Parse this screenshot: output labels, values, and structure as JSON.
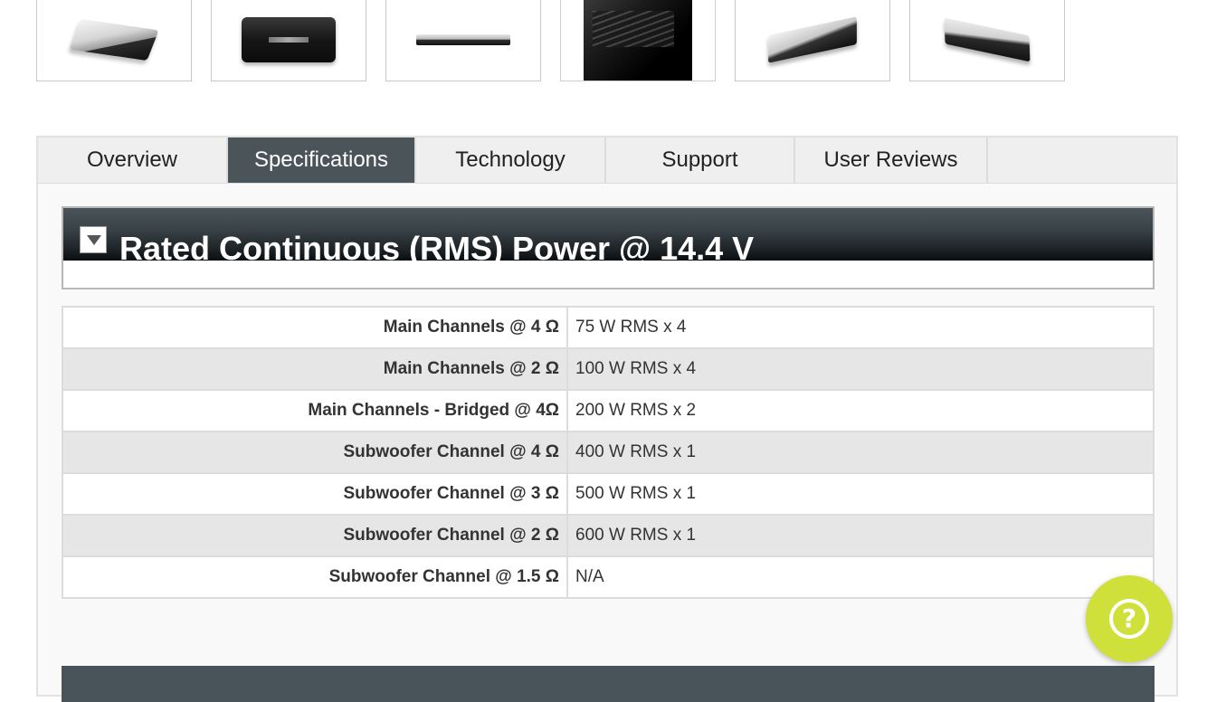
{
  "thumbnails": [
    {
      "icon": "amplifier-silver-angle-image"
    },
    {
      "icon": "amplifier-black-top-image"
    },
    {
      "icon": "amplifier-side-profile-image"
    },
    {
      "icon": "amplifier-closeup-dark-image"
    },
    {
      "icon": "amplifier-open-panel-image"
    },
    {
      "icon": "amplifier-silver-tilted-image"
    }
  ],
  "tabs": [
    {
      "label": "Overview",
      "active": false
    },
    {
      "label": "Specifications",
      "active": true
    },
    {
      "label": "Technology",
      "active": false
    },
    {
      "label": "Support",
      "active": false
    },
    {
      "label": "User Reviews",
      "active": false
    }
  ],
  "section": {
    "title": "Rated Continuous (RMS) Power @ 14.4 V"
  },
  "specs": [
    {
      "label": "Main Channels @ 4 Ω",
      "value": "75 W RMS x 4"
    },
    {
      "label": "Main Channels @ 2 Ω",
      "value": "100 W RMS x 4"
    },
    {
      "label": "Main Channels - Bridged @ 4Ω",
      "value": "200 W RMS x 2"
    },
    {
      "label": "Subwoofer Channel @ 4 Ω",
      "value": "400 W RMS x 1"
    },
    {
      "label": "Subwoofer Channel @ 3 Ω",
      "value": "500 W RMS x 1"
    },
    {
      "label": "Subwoofer Channel @ 2 Ω",
      "value": "600 W RMS x 1"
    },
    {
      "label": "Subwoofer Channel @ 1.5 Ω",
      "value": "N/A"
    }
  ],
  "help": {
    "glyph": "?"
  },
  "colors": {
    "tab_active": "#4a5459",
    "help_button": "#cfe03a",
    "row_alt": "#e6e6e6"
  }
}
